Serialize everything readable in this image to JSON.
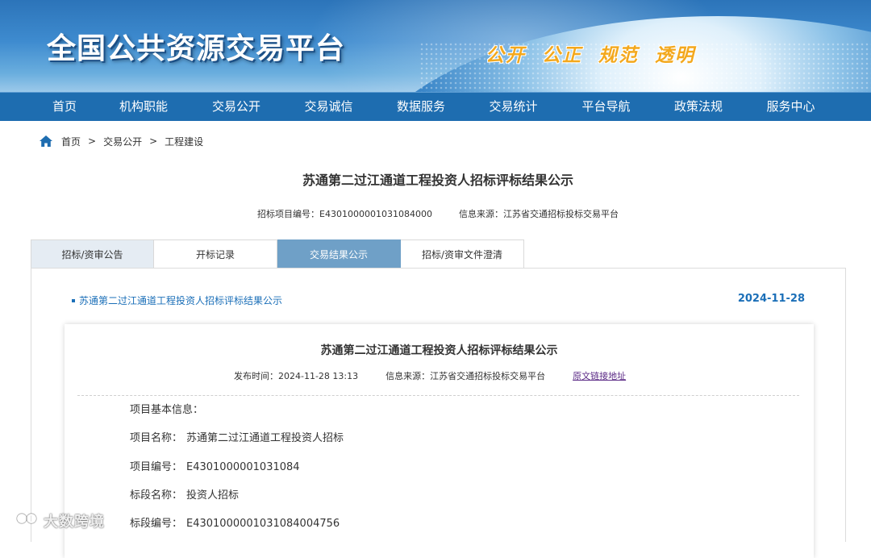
{
  "site": {
    "title": "全国公共资源交易平台",
    "slogan": "公开 公正 规范 透明"
  },
  "nav": [
    "首页",
    "机构职能",
    "交易公开",
    "交易诚信",
    "数据服务",
    "交易统计",
    "平台导航",
    "政策法规",
    "服务中心"
  ],
  "breadcrumb": {
    "items": [
      "首页",
      "交易公开",
      "工程建设"
    ],
    "separator": ">"
  },
  "page": {
    "title": "苏通第二过江通道工程投资人招标评标结果公示",
    "project_no": "招标项目编号：E4301000001031084000",
    "source": "信息来源：江苏省交通招标投标交易平台"
  },
  "tabs": {
    "items": [
      "招标/资审公告",
      "开标记录",
      "交易结果公示",
      "招标/资审文件澄清"
    ],
    "active_index": 2
  },
  "notice": {
    "link_text": "苏通第二过江通道工程投资人招标评标结果公示",
    "date": "2024-11-28"
  },
  "detail": {
    "title": "苏通第二过江通道工程投资人招标评标结果公示",
    "publish_time": "发布时间：2024-11-28 13:13",
    "source": "信息来源：江苏省交通招标投标交易平台",
    "original_link": "原文链接地址",
    "section_heading": "项目基本信息：",
    "rows": [
      {
        "key": "项目名称：",
        "value": "苏通第二过江通道工程投资人招标"
      },
      {
        "key": "项目编号：",
        "value": "E4301000001031084"
      },
      {
        "key": "标段名称：",
        "value": "投资人招标"
      },
      {
        "key": "标段编号：",
        "value": "E4301000001031084004756"
      }
    ]
  },
  "watermark": {
    "text": "大数跨境"
  },
  "colors": {
    "nav_bg": "#1e6db0",
    "tab_active": "#6fa0c7",
    "link": "#1b6fb8",
    "slogan": "#f3a81d"
  }
}
